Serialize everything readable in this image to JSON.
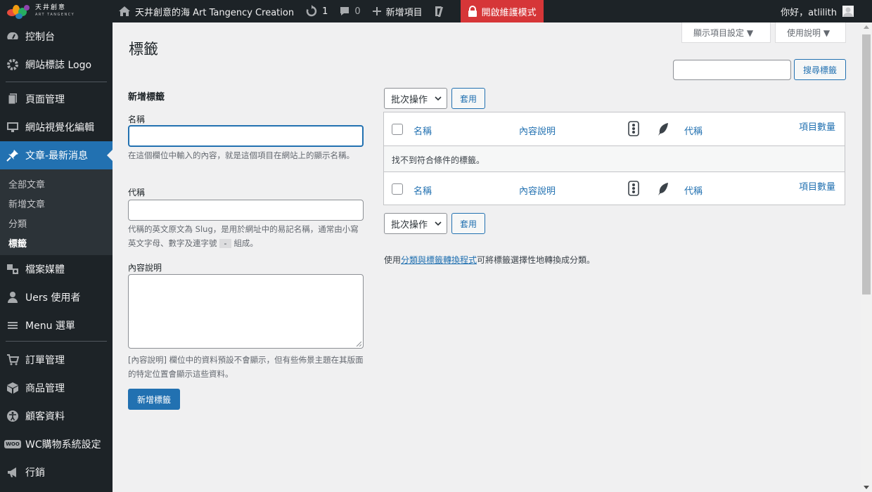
{
  "adminbar": {
    "logo_zh": "天井創意",
    "logo_en": "ART TANGENCY",
    "site_name": "天井創意的海 Art Tangency Creation",
    "updates_count": "1",
    "comments_count": "0",
    "new_item": "新增項目",
    "maintenance": "開啟維護模式",
    "greeting": "你好，atlilith"
  },
  "sidebar": {
    "items": [
      {
        "label": "控制台",
        "icon": "dashboard-icon"
      },
      {
        "label": "網站標誌 Logo",
        "icon": "gear-icon"
      },
      {
        "label": "頁面管理",
        "icon": "pages-icon"
      },
      {
        "label": "網站視覺化編輯",
        "icon": "monitor-icon"
      },
      {
        "label": "文章-最新消息",
        "icon": "pin-icon"
      },
      {
        "label": "檔案媒體",
        "icon": "media-icon"
      },
      {
        "label": "Uers 使用者",
        "icon": "user-icon"
      },
      {
        "label": "Menu 選單",
        "icon": "menu-icon"
      },
      {
        "label": "訂單管理",
        "icon": "cart-icon"
      },
      {
        "label": "商品管理",
        "icon": "box-icon"
      },
      {
        "label": "顧客資料",
        "icon": "accessibility-icon"
      },
      {
        "label": "WC購物系統設定",
        "icon": "woo-icon"
      },
      {
        "label": "行銷",
        "icon": "megaphone-icon"
      }
    ],
    "woo_badge": "WOO",
    "submenu": [
      "全部文章",
      "新增文章",
      "分類",
      "標籤"
    ]
  },
  "screen_options": "顯示項目設定 ▼",
  "help": "使用說明 ▼",
  "page_title": "標籤",
  "search_button": "搜尋標籤",
  "form": {
    "heading": "新增標籤",
    "name_label": "名稱",
    "name_value": "",
    "name_help": "在這個欄位中輸入的內容，就是這個項目在網站上的顯示名稱。",
    "slug_label": "代稱",
    "slug_value": "",
    "slug_help_pre": "代稱的英文原文為 Slug，是用於網址中的易記名稱，通常由小寫英文字母、數字及連字號",
    "slug_help_code": "-",
    "slug_help_post": "組成。",
    "desc_label": "內容說明",
    "desc_value": "",
    "desc_help": "[內容說明] 欄位中的資料預設不會顯示，但有些佈景主題在其版面的特定位置會顯示這些資料。",
    "submit": "新增標籤"
  },
  "bulk": {
    "select": "批次操作",
    "apply": "套用"
  },
  "table": {
    "columns": [
      "名稱",
      "內容說明",
      "代稱",
      "項目數量"
    ],
    "empty": "找不到符合條件的標籤。"
  },
  "footer": {
    "pre": "使用",
    "link": "分類與標籤轉換程式",
    "post": "可將標籤選擇性地轉換成分類。"
  },
  "colors": {
    "accent": "#2271b1",
    "adminbar": "#1d2327",
    "maintenance": "#d63638"
  }
}
